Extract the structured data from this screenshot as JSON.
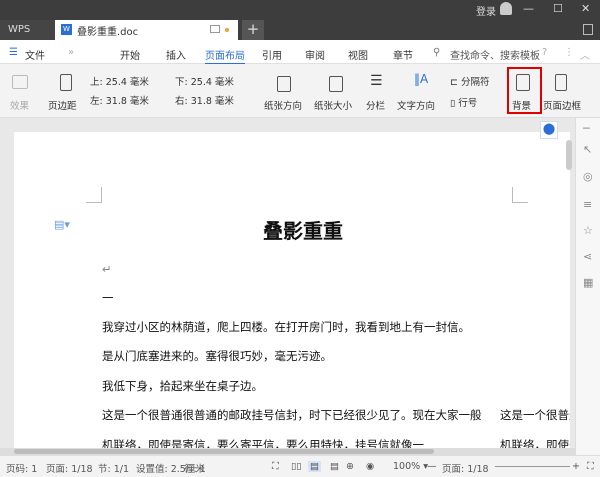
{
  "titlebar": {
    "login": "登录",
    "minimize": "—",
    "maximize": "☐",
    "close": "✕"
  },
  "tabs": {
    "wps": "WPS",
    "doc": "叠影重重.doc",
    "doc_icon": "W",
    "new": "+"
  },
  "menu": {
    "file": "文件",
    "items": [
      "开始",
      "插入",
      "页面布局",
      "引用",
      "审阅",
      "视图",
      "章节"
    ],
    "active": "页面布局",
    "search": "查找命令、搜索模板",
    "help": "?"
  },
  "ribbon": {
    "effect": "效果",
    "margin": "页边距",
    "top_label": "上:",
    "top": "25.4 毫米",
    "bottom_label": "下:",
    "bottom": "25.4 毫米",
    "left_label": "左:",
    "left": "31.8 毫米",
    "right_label": "右:",
    "right": "31.8 毫米",
    "orientation": "纸张方向",
    "size": "纸张大小",
    "columns": "分栏",
    "text_dir": "文字方向",
    "separator": "分隔符",
    "line_num": "行号",
    "background": "背景",
    "page_border": "页面边框",
    "highlight_color": "#e00000"
  },
  "document": {
    "title": "叠影重重",
    "paragraphs": [
      "一",
      "我穿过小区的林荫道，爬上四楼。在打开房门时，我看到地上有一封信。",
      "是从门底塞进来的。塞得很巧妙，毫无污迹。",
      "我低下身，拾起来坐在桌子边。",
      "这是一个很普通很普通的邮政挂号信封，时下已经很少见了。现在大家一般",
      "机联络，即使是寄信，要么寄平信，要么用特快，挂号信就像一"
    ],
    "overflow": [
      "这是一个很普通很普",
      "机联络，即使是寄信"
    ]
  },
  "status": {
    "page_no": "页码: 1",
    "pages": "页面: 1/18",
    "section": "节: 1/1",
    "setting": "设置值: 2.5厘米",
    "line": "行: 1",
    "zoom": "100%",
    "page_nav": "页面: 1/18"
  }
}
